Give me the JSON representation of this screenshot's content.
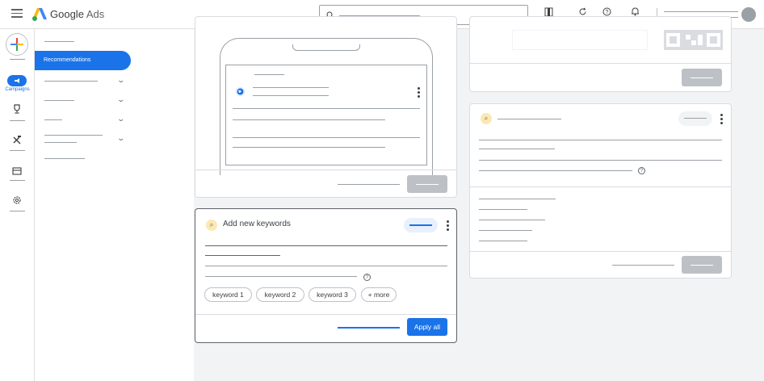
{
  "header": {
    "brand_google": "Google",
    "brand_ads": "Ads"
  },
  "rail": {
    "campaigns_label": "Campaigns"
  },
  "nav": {
    "active_item": "Recommendations"
  },
  "keywords_card": {
    "title": "Add new keywords",
    "chips": [
      "keyword 1",
      "keyword 2",
      "keyword 3",
      "+ more"
    ],
    "apply_label": "Apply all"
  },
  "colors": {
    "accent": "#1a73e8",
    "badge": "#fce8b2",
    "disabled_button": "#bdc1c6"
  }
}
